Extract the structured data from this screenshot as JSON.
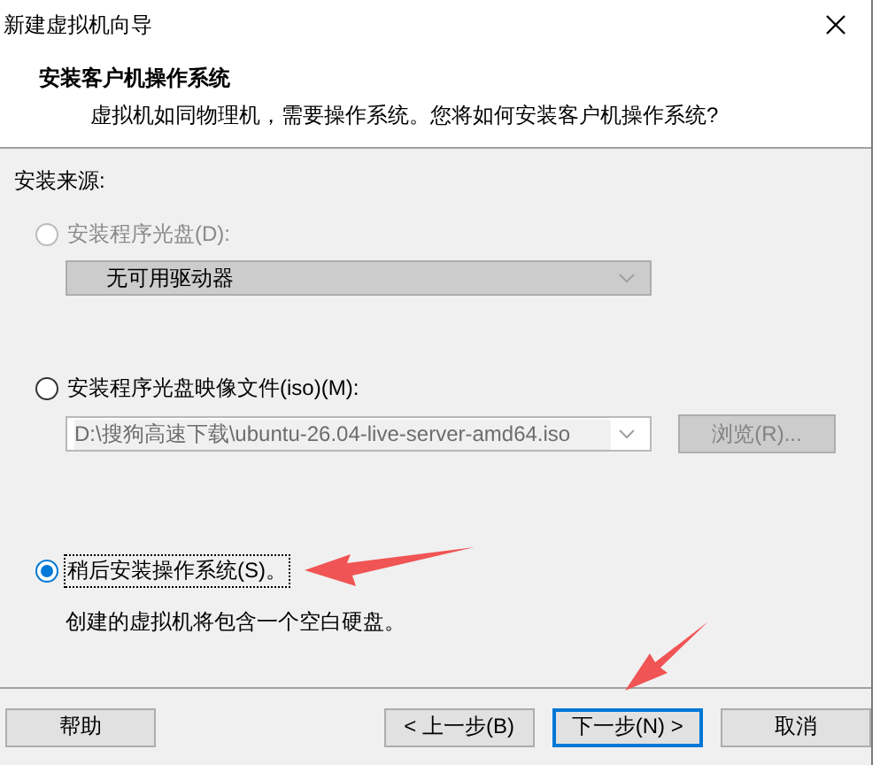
{
  "window": {
    "title": "新建虚拟机向导"
  },
  "header": {
    "title": "安装客户机操作系统",
    "subtitle": "虚拟机如同物理机，需要操作系统。您将如何安装客户机操作系统?"
  },
  "section_label": "安装来源:",
  "options": [
    {
      "kind": "dropdown",
      "label": "安装程序光盘(D):",
      "selected": false,
      "disabled": true,
      "focused": false,
      "field": {
        "value": "无可用驱动器",
        "disabled": true
      }
    },
    {
      "kind": "file",
      "label": "安装程序光盘映像文件(iso)(M):",
      "selected": false,
      "disabled": false,
      "focused": false,
      "field": {
        "value": "D:\\搜狗高速下载\\ubuntu-26.04-live-server-amd64.iso",
        "disabled": true
      },
      "browse": {
        "label": "浏览(R)...",
        "disabled": true
      }
    },
    {
      "kind": "note",
      "label": "稍后安装操作系统(S)。",
      "selected": true,
      "disabled": false,
      "focused": true,
      "description": "创建的虚拟机将包含一个空白硬盘。"
    }
  ],
  "buttons": [
    {
      "label": "帮助",
      "default": false
    },
    {
      "label": "< 上一步(B)",
      "default": false
    },
    {
      "label": "下一步(N) >",
      "default": true
    },
    {
      "label": "取消",
      "default": false
    }
  ]
}
